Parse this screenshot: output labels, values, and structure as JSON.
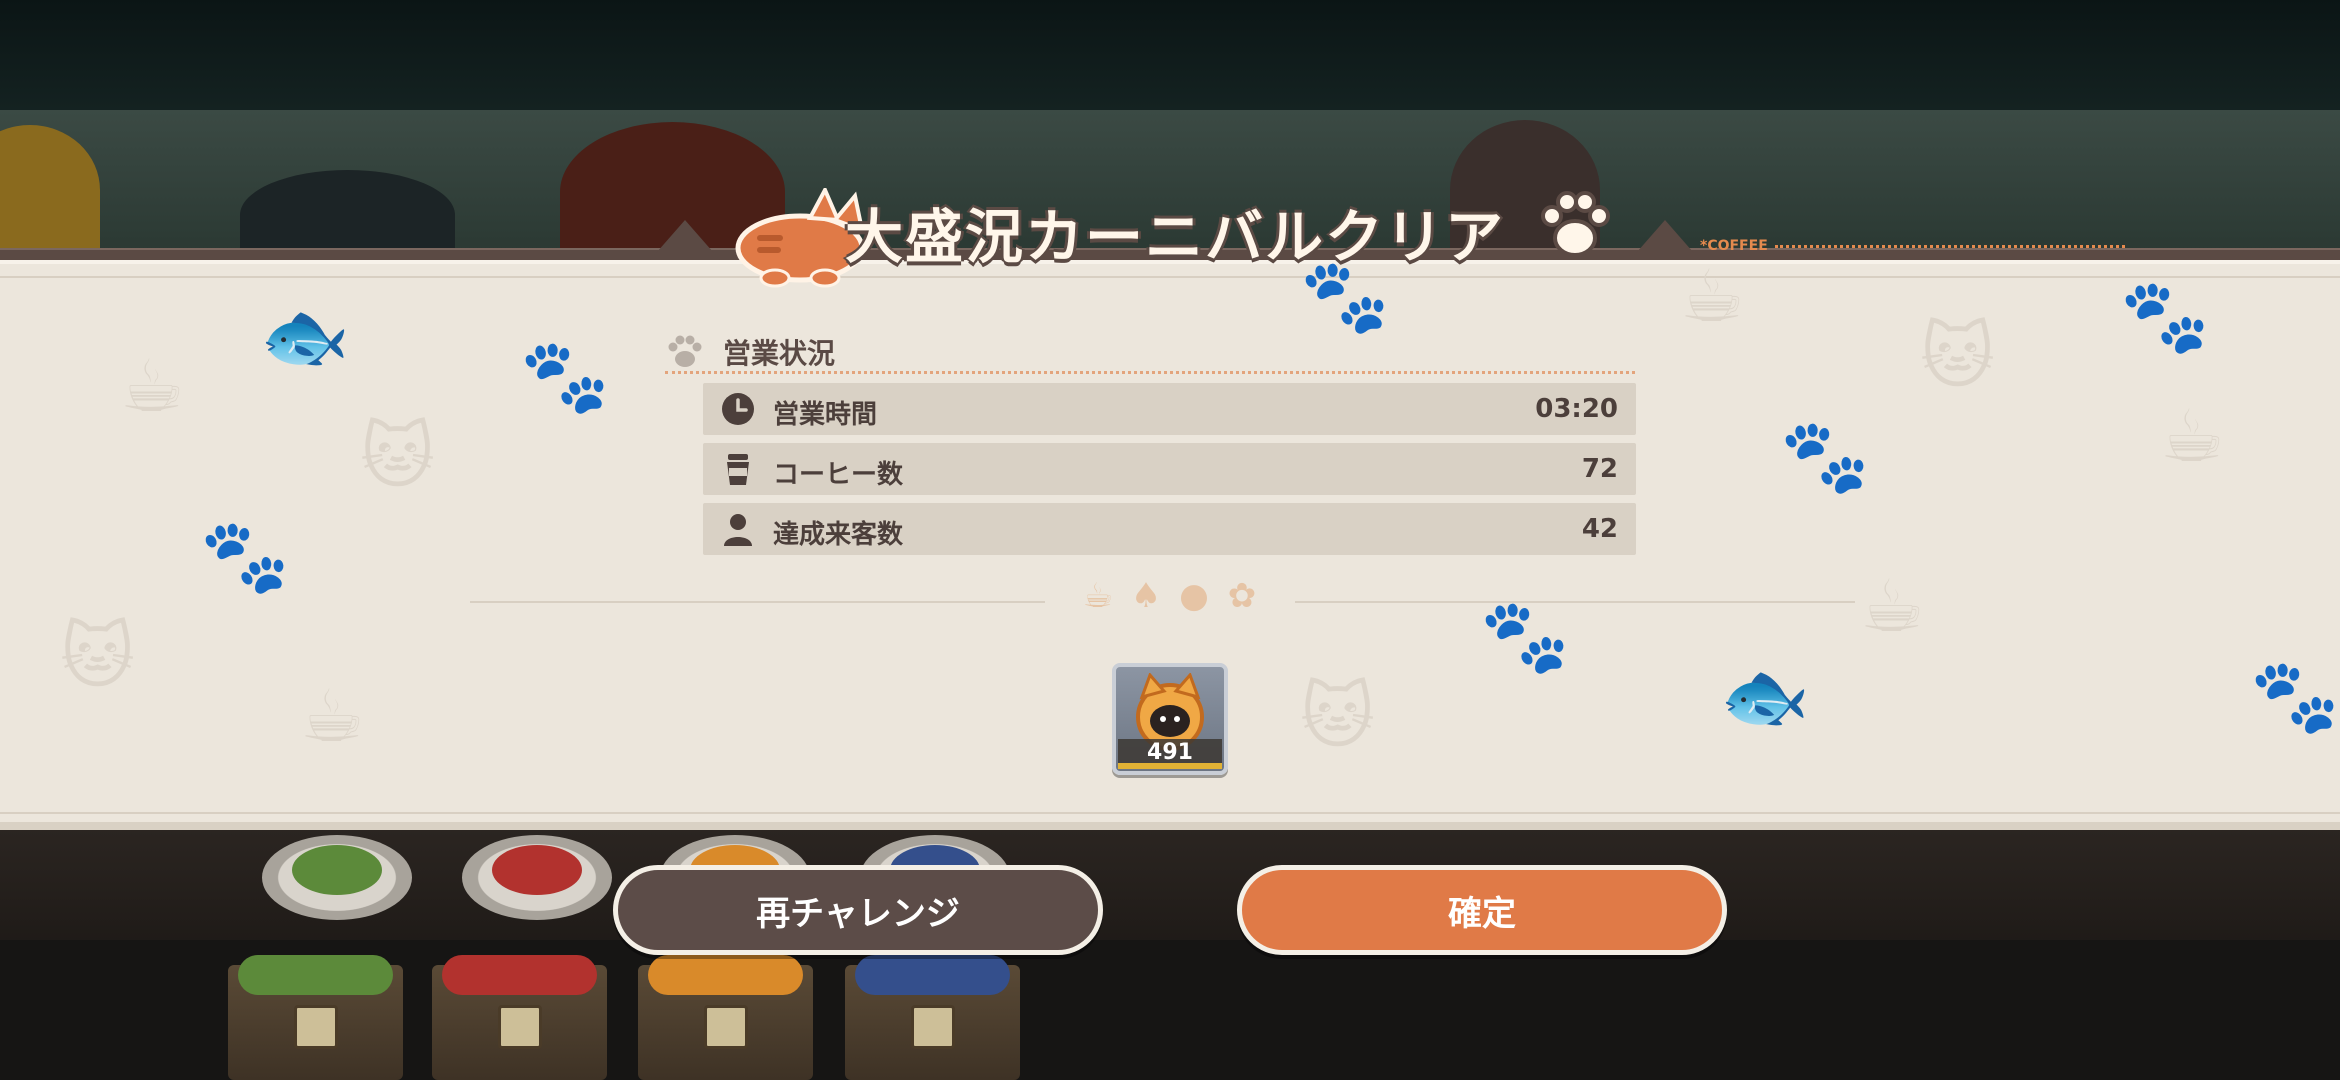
{
  "dialog": {
    "title": "大盛況カーニバルクリア",
    "brand_tag": "*COFFEE"
  },
  "stats": {
    "section_label": "営業状況",
    "rows": [
      {
        "icon": "clock-icon",
        "label": "営業時間",
        "value": "03:20"
      },
      {
        "icon": "coffee-cup-icon",
        "label": "コーヒー数",
        "value": "72"
      },
      {
        "icon": "person-icon",
        "label": "達成来客数",
        "value": "42"
      }
    ]
  },
  "reward": {
    "icon": "cat-coin-icon",
    "count": "491"
  },
  "buttons": {
    "retry_label": "再チャレンジ",
    "confirm_label": "確定"
  },
  "colors": {
    "accent_orange": "#e07a47",
    "dark_brown": "#5c4c48",
    "panel_bg": "#ece6dc",
    "stat_row_bg": "#d9d1c5"
  }
}
